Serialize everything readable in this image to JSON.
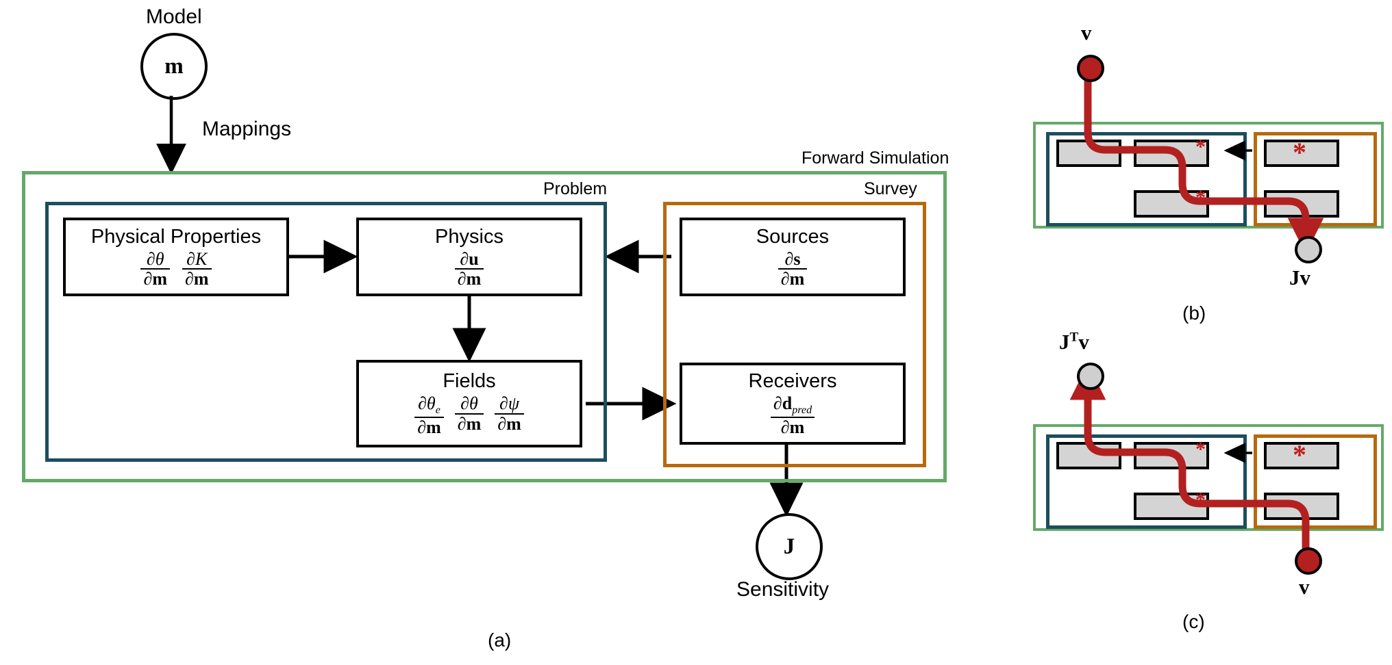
{
  "figure": {
    "panels": [
      {
        "id": "a",
        "caption": "(a)"
      },
      {
        "id": "b",
        "caption": "(b)"
      },
      {
        "id": "c",
        "caption": "(c)"
      }
    ]
  },
  "colors": {
    "forward_simulation_green": "#64a96a",
    "problem_teal": "#1c4e5e",
    "survey_orange": "#b8690e",
    "path_red": "#b32020",
    "node_fill_gray": "#d4d4d4",
    "black": "#000000"
  },
  "panel_a": {
    "model": {
      "label": "Model",
      "symbol": "m",
      "edge_label": "Mappings"
    },
    "groups": {
      "forward_simulation": "Forward Simulation",
      "problem": "Problem",
      "survey": "Survey"
    },
    "boxes": [
      {
        "name": "physical-properties",
        "title": "Physical Properties",
        "derivatives": [
          {
            "num_sym": "θ",
            "num_italic": true,
            "num_sub": "",
            "den": "m"
          },
          {
            "num_sym": "K",
            "num_italic": true,
            "num_sub": "",
            "den": "m"
          }
        ]
      },
      {
        "name": "physics",
        "title": "Physics",
        "derivatives": [
          {
            "num_sym": "u",
            "num_italic": false,
            "num_sub": "",
            "den": "m"
          }
        ]
      },
      {
        "name": "fields",
        "title": "Fields",
        "derivatives": [
          {
            "num_sym": "θ",
            "num_italic": true,
            "num_sub": "e",
            "den": "m"
          },
          {
            "num_sym": "θ",
            "num_italic": true,
            "num_sub": "",
            "den": "m"
          },
          {
            "num_sym": "ψ",
            "num_italic": true,
            "num_sub": "",
            "den": "m"
          }
        ]
      },
      {
        "name": "sources",
        "title": "Sources",
        "derivatives": [
          {
            "num_sym": "s",
            "num_italic": false,
            "num_sub": "",
            "den": "m"
          }
        ]
      },
      {
        "name": "receivers",
        "title": "Receivers",
        "derivatives": [
          {
            "num_sym": "d",
            "num_italic": false,
            "num_sub": "pred",
            "den": "m"
          }
        ]
      }
    ],
    "sensitivity": {
      "symbol": "J",
      "label": "Sensitivity"
    },
    "caption": "(a)"
  },
  "panel_b": {
    "input_label": "v",
    "output_label": "Jv",
    "star_marks": [
      "*",
      "*",
      "*"
    ],
    "caption": "(b)",
    "groups": {
      "forward_simulation": "Forward Simulation",
      "problem": "Problem",
      "survey": "Survey"
    }
  },
  "panel_c": {
    "input_label": "v",
    "output_label": "Jᵀv",
    "output_base": "J",
    "output_sup": "T",
    "output_tail": "v",
    "star_marks": [
      "*",
      "*",
      "*"
    ],
    "caption": "(c)",
    "groups": {
      "forward_simulation": "Forward Simulation",
      "problem": "Problem",
      "survey": "Survey"
    }
  }
}
